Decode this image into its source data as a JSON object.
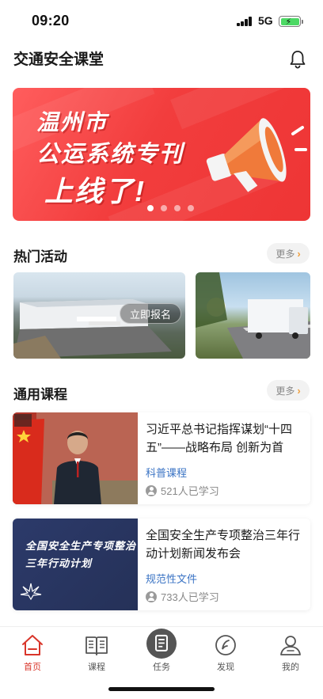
{
  "status_bar": {
    "time": "09:20",
    "network": "5G"
  },
  "header": {
    "title": "交通安全课堂",
    "bell_icon": "bell-icon"
  },
  "banner": {
    "line1": "温州市",
    "line2": "公运系统专刊",
    "line3": "上线了!",
    "icon": "megaphone-icon",
    "slide_count": 4,
    "active_slide": 1,
    "colors": {
      "background": "#f23d3d",
      "megaphone": "#f07a3a"
    }
  },
  "hot_activities": {
    "title": "热门活动",
    "more_label": "更多",
    "items": [
      {
        "button_label": "立即报名"
      },
      {}
    ]
  },
  "general_courses": {
    "title": "通用课程",
    "more_label": "更多",
    "items": [
      {
        "title": "习近平总书记指挥谋划“十四五”——战略布局 创新为首",
        "tag": "科普课程",
        "learners": "521人已学习"
      },
      {
        "title": "全国安全生产专项整治三年行动计划新闻发布会",
        "tag": "规范性文件",
        "learners": "733人已学习",
        "thumb_text_line1": "全国安全生产专项整治",
        "thumb_text_line2": "三年行动计划"
      }
    ]
  },
  "tab_bar": {
    "tabs": [
      {
        "label": "首页",
        "icon": "home-icon",
        "active": true
      },
      {
        "label": "课程",
        "icon": "book-icon"
      },
      {
        "label": "任务",
        "icon": "task-icon"
      },
      {
        "label": "发现",
        "icon": "compass-icon"
      },
      {
        "label": "我的",
        "icon": "profile-icon"
      }
    ],
    "accent_color": "#d9352a"
  }
}
